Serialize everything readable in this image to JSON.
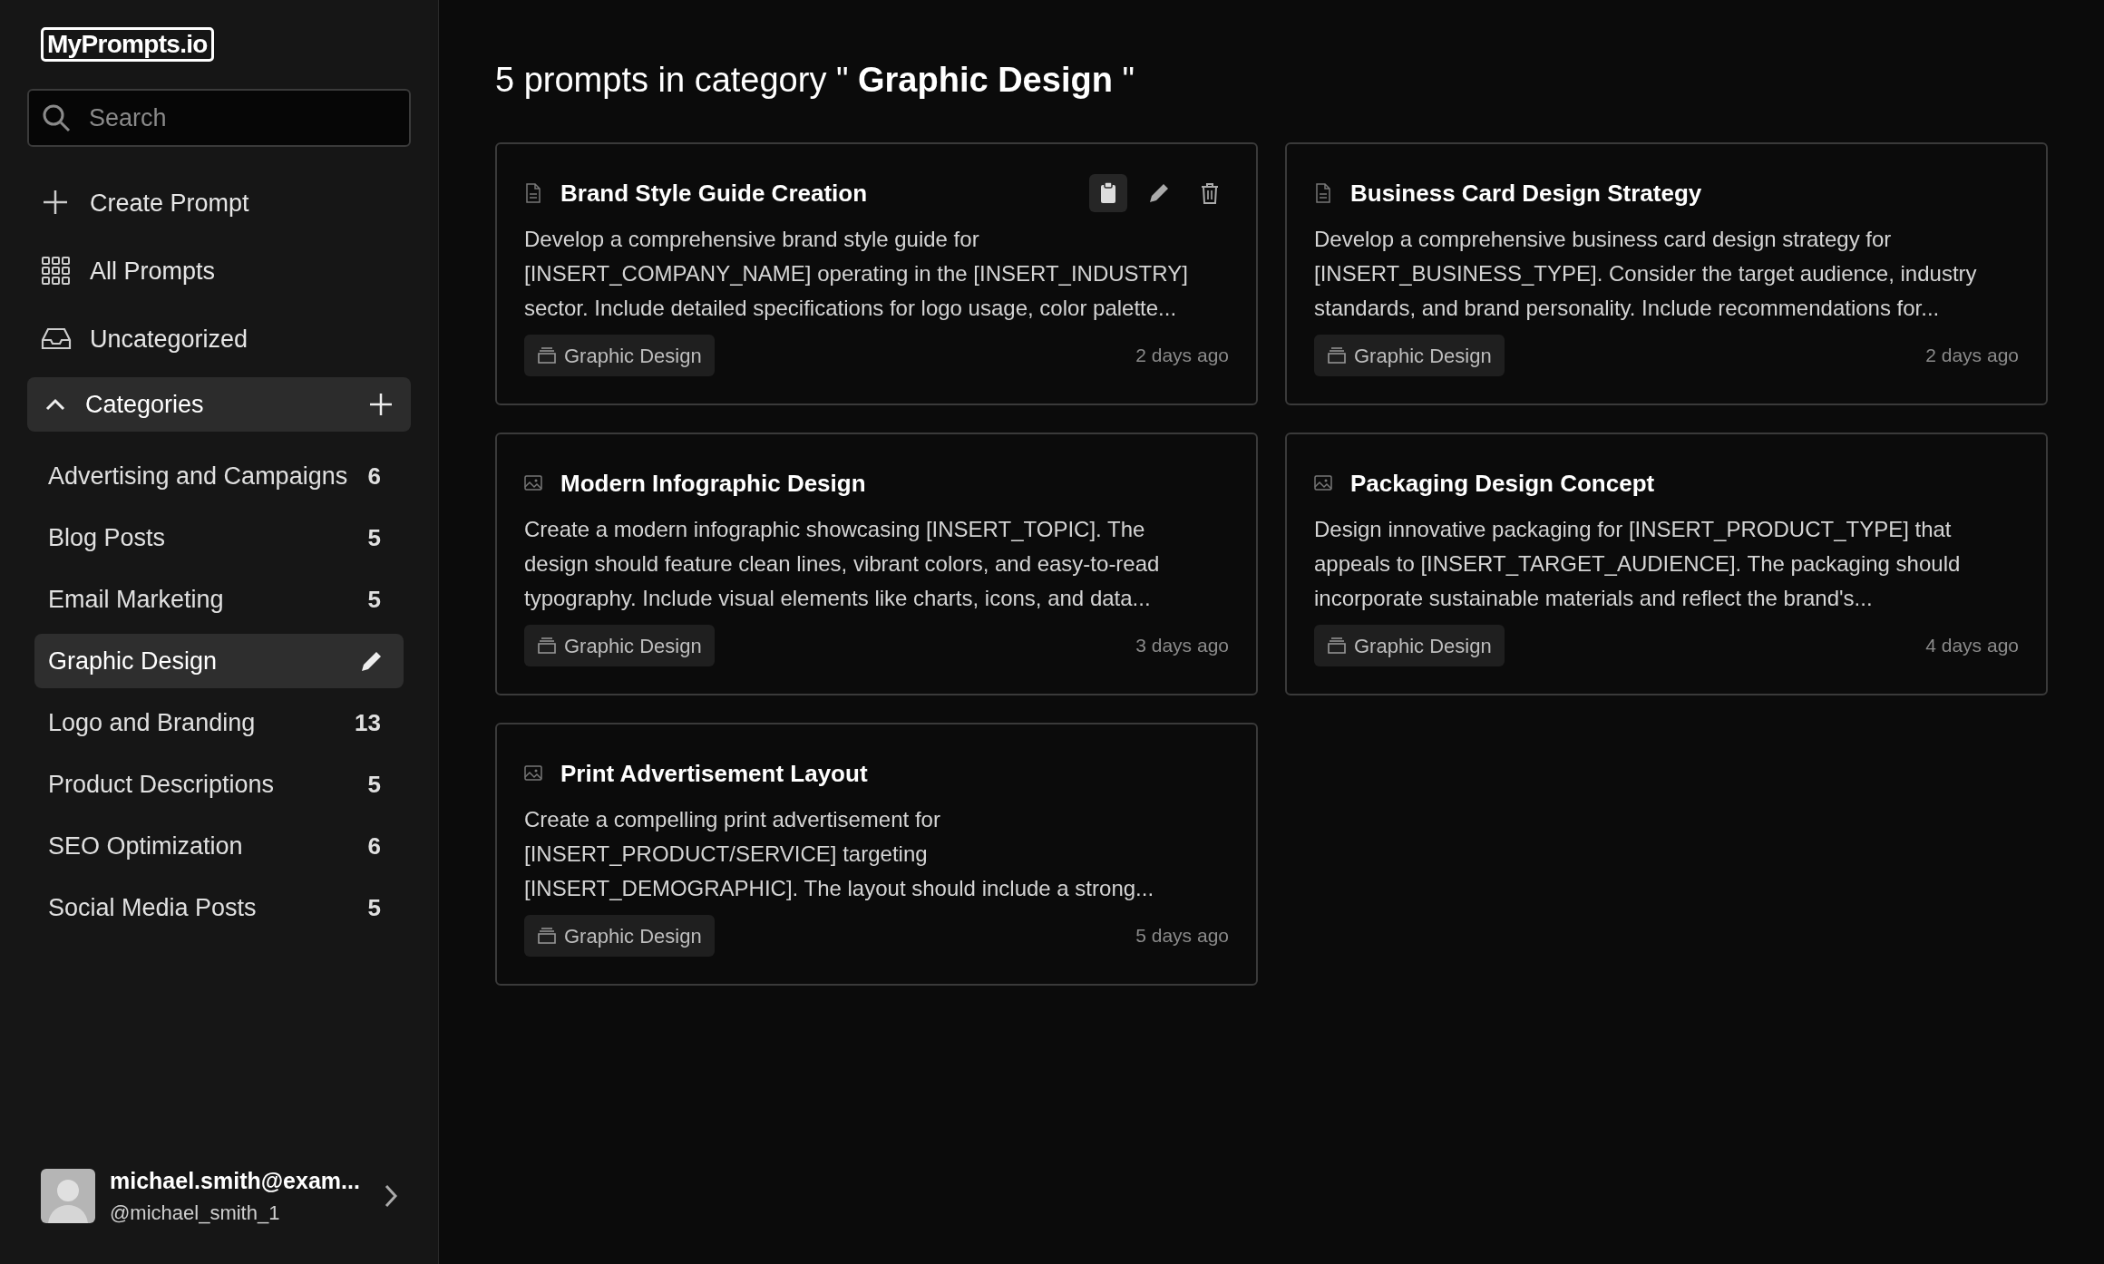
{
  "logo": {
    "text": "MyPrompts.io"
  },
  "search": {
    "placeholder": "Search"
  },
  "nav": [
    {
      "label": "Create Prompt",
      "kind": "create"
    },
    {
      "label": "All Prompts",
      "kind": "all"
    },
    {
      "label": "Uncategorized",
      "kind": "inbox"
    }
  ],
  "categories_header": {
    "label": "Categories",
    "expanded": true
  },
  "categories": [
    {
      "name": "Advertising and Campaigns",
      "count": "6",
      "selected": false
    },
    {
      "name": "Blog Posts",
      "count": "5",
      "selected": false
    },
    {
      "name": "Email Marketing",
      "count": "5",
      "selected": false
    },
    {
      "name": "Graphic Design",
      "selected": true
    },
    {
      "name": "Logo and Branding",
      "count": "13",
      "selected": false
    },
    {
      "name": "Product Descriptions",
      "count": "5",
      "selected": false
    },
    {
      "name": "SEO Optimization",
      "count": "6",
      "selected": false
    },
    {
      "name": "Social Media Posts",
      "count": "5",
      "selected": false
    }
  ],
  "user": {
    "email": "michael.smith@exam...",
    "handle": "@michael_smith_1"
  },
  "heading": {
    "prefix": "5 prompts in category \" ",
    "category": "Graphic Design",
    "suffix": " \""
  },
  "prompts": [
    {
      "kind": "document",
      "title": "Brand Style Guide Creation",
      "hovered": true,
      "lines": [
        "Develop a comprehensive brand style guide for",
        "[INSERT_COMPANY_NAME] operating in the [INSERT_INDUSTRY]",
        "sector. Include detailed specifications for logo usage, color palette..."
      ],
      "tag": "Graphic Design",
      "time": "2 days ago"
    },
    {
      "kind": "document",
      "title": "Business Card Design Strategy",
      "hovered": false,
      "lines": [
        "Develop a comprehensive business card design strategy for",
        "[INSERT_BUSINESS_TYPE]. Consider the target audience, industry",
        "standards, and brand personality. Include recommendations for..."
      ],
      "tag": "Graphic Design",
      "time": "2 days ago"
    },
    {
      "kind": "image",
      "title": "Modern Infographic Design",
      "hovered": false,
      "lines": [
        "Create a modern infographic showcasing [INSERT_TOPIC]. The",
        "design should feature clean lines, vibrant colors, and easy-to-read",
        "typography. Include visual elements like charts, icons, and data..."
      ],
      "tag": "Graphic Design",
      "time": "3 days ago"
    },
    {
      "kind": "image",
      "title": "Packaging Design Concept",
      "hovered": false,
      "lines": [
        "Design innovative packaging for [INSERT_PRODUCT_TYPE] that",
        "appeals to [INSERT_TARGET_AUDIENCE]. The packaging should",
        "incorporate sustainable materials and reflect the brand's..."
      ],
      "tag": "Graphic Design",
      "time": "4 days ago"
    },
    {
      "kind": "image",
      "title": "Print Advertisement Layout",
      "hovered": false,
      "lines": [
        "Create a compelling print advertisement for",
        "[INSERT_PRODUCT/SERVICE] targeting",
        "[INSERT_DEMOGRAPHIC]. The layout should include a strong..."
      ],
      "tag": "Graphic Design",
      "time": "5 days ago"
    }
  ]
}
